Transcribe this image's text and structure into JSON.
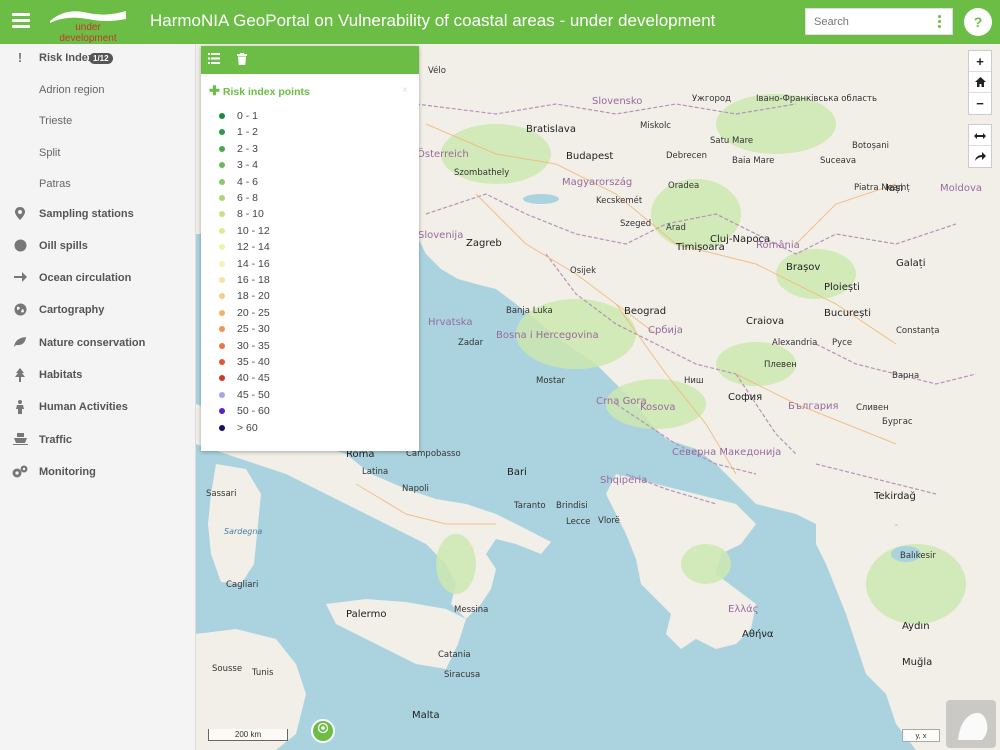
{
  "header": {
    "logo_text": "under development",
    "title": "HarmoNIA GeoPortal on Vulnerability of coastal areas - under development",
    "search_placeholder": "Search",
    "help_label": "?"
  },
  "sidebar": {
    "items": [
      {
        "label": "Risk Index",
        "badge": "1/12",
        "icon": "exclamation-icon"
      },
      {
        "label": "Adrion region"
      },
      {
        "label": "Trieste"
      },
      {
        "label": "Split"
      },
      {
        "label": "Patras"
      },
      {
        "label": "Sampling stations",
        "icon": "map-marker-icon"
      },
      {
        "label": "Oill spills",
        "icon": "circle-icon"
      },
      {
        "label": "Ocean circulation",
        "icon": "arrow-right-icon"
      },
      {
        "label": "Cartography",
        "icon": "globe-icon"
      },
      {
        "label": "Nature conservation",
        "icon": "leaf-icon"
      },
      {
        "label": "Habitats",
        "icon": "tree-icon"
      },
      {
        "label": "Human Activities",
        "icon": "person-icon"
      },
      {
        "label": "Traffic",
        "icon": "ship-icon"
      },
      {
        "label": "Monitoring",
        "icon": "cogs-icon"
      }
    ]
  },
  "legend": {
    "title": "Risk index points",
    "close": "×",
    "classes": [
      {
        "label": "0 - 1",
        "color": "#1a8a3a"
      },
      {
        "label": "1 - 2",
        "color": "#2e9a45"
      },
      {
        "label": "2 - 3",
        "color": "#49a94f"
      },
      {
        "label": "3 - 4",
        "color": "#6bb95a"
      },
      {
        "label": "4 - 6",
        "color": "#8cc866"
      },
      {
        "label": "6 - 8",
        "color": "#acd675"
      },
      {
        "label": "8 - 10",
        "color": "#c6e283"
      },
      {
        "label": "10 - 12",
        "color": "#dceb97"
      },
      {
        "label": "12 - 14",
        "color": "#edf2ad"
      },
      {
        "label": "14 - 16",
        "color": "#f8f1b5"
      },
      {
        "label": "16 - 18",
        "color": "#fbe2a2"
      },
      {
        "label": "18 - 20",
        "color": "#f9cc85"
      },
      {
        "label": "20 - 25",
        "color": "#f6b06a"
      },
      {
        "label": "25 - 30",
        "color": "#f29355"
      },
      {
        "label": "30 - 35",
        "color": "#ec7443"
      },
      {
        "label": "35 - 40",
        "color": "#e15535"
      },
      {
        "label": "40 - 45",
        "color": "#d0382c"
      },
      {
        "label": "45 - 50",
        "color": "#a4a4f0"
      },
      {
        "label": "50 - 60",
        "color": "#5a22c8"
      },
      {
        "label": "> 60",
        "color": "#1a0a6a"
      }
    ]
  },
  "map": {
    "scale_label": "200 km",
    "coords_label": "y, x",
    "places": [
      {
        "text": "Vélo",
        "cls": ""
      },
      {
        "text": "Slovensko",
        "cls": "country"
      },
      {
        "text": "Ужгород",
        "cls": ""
      },
      {
        "text": "Івано-Франківська область",
        "cls": ""
      },
      {
        "text": "Bratislava",
        "cls": "big"
      },
      {
        "text": "Miskolc",
        "cls": ""
      },
      {
        "text": "Budapest",
        "cls": "big"
      },
      {
        "text": "Debrecen",
        "cls": ""
      },
      {
        "text": "Satu Mare",
        "cls": ""
      },
      {
        "text": "Baia Mare",
        "cls": ""
      },
      {
        "text": "Suceava",
        "cls": ""
      },
      {
        "text": "Österreich",
        "cls": "country"
      },
      {
        "text": "Magyarország",
        "cls": "country"
      },
      {
        "text": "Oradea",
        "cls": ""
      },
      {
        "text": "Botoșani",
        "cls": ""
      },
      {
        "text": "Iași",
        "cls": "big"
      },
      {
        "text": "Moldova",
        "cls": "country"
      },
      {
        "text": "Szombathely",
        "cls": ""
      },
      {
        "text": "Kecskemét",
        "cls": ""
      },
      {
        "text": "Cluj-Napoca",
        "cls": "big"
      },
      {
        "text": "Piatra Neamț",
        "cls": ""
      },
      {
        "text": "Slovenija",
        "cls": "country"
      },
      {
        "text": "Zagreb",
        "cls": "big"
      },
      {
        "text": "Szeged",
        "cls": ""
      },
      {
        "text": "Arad",
        "cls": ""
      },
      {
        "text": "Timișoara",
        "cls": "big"
      },
      {
        "text": "România",
        "cls": "country"
      },
      {
        "text": "Brașov",
        "cls": "big"
      },
      {
        "text": "Galați",
        "cls": "big"
      },
      {
        "text": "Osijek",
        "cls": ""
      },
      {
        "text": "Ploiești",
        "cls": "big"
      },
      {
        "text": "Hrvatska",
        "cls": "country"
      },
      {
        "text": "Banja Luka",
        "cls": ""
      },
      {
        "text": "Beograd",
        "cls": "big"
      },
      {
        "text": "Craiova",
        "cls": "big"
      },
      {
        "text": "București",
        "cls": "big"
      },
      {
        "text": "Bosna i Hercegovina",
        "cls": "country"
      },
      {
        "text": "Србија",
        "cls": "country"
      },
      {
        "text": "Constanța",
        "cls": ""
      },
      {
        "text": "Zadar",
        "cls": ""
      },
      {
        "text": "Alexandria",
        "cls": ""
      },
      {
        "text": "Русе",
        "cls": ""
      },
      {
        "text": "Плевен",
        "cls": ""
      },
      {
        "text": "Варна",
        "cls": ""
      },
      {
        "text": "Mostar",
        "cls": ""
      },
      {
        "text": "Ниш",
        "cls": ""
      },
      {
        "text": "Crna Gora",
        "cls": "country"
      },
      {
        "text": "Kosova",
        "cls": "country"
      },
      {
        "text": "София",
        "cls": "big"
      },
      {
        "text": "България",
        "cls": "country"
      },
      {
        "text": "Сливен",
        "cls": ""
      },
      {
        "text": "Бургас",
        "cls": ""
      },
      {
        "text": "Roma",
        "cls": "big"
      },
      {
        "text": "Campobasso",
        "cls": ""
      },
      {
        "text": "Bari",
        "cls": "big"
      },
      {
        "text": "Северна Македонија",
        "cls": "country"
      },
      {
        "text": "Latina",
        "cls": ""
      },
      {
        "text": "Shqipëria",
        "cls": "country"
      },
      {
        "text": "Tekirdağ",
        "cls": "big"
      },
      {
        "text": "Sassari",
        "cls": ""
      },
      {
        "text": "Napoli",
        "cls": ""
      },
      {
        "text": "Taranto",
        "cls": ""
      },
      {
        "text": "Brindisi",
        "cls": ""
      },
      {
        "text": "Lecce",
        "cls": ""
      },
      {
        "text": "Vlorë",
        "cls": ""
      },
      {
        "text": "Sardegna",
        "cls": "sea"
      },
      {
        "text": "Balıkesir",
        "cls": ""
      },
      {
        "text": "Cagliari",
        "cls": ""
      },
      {
        "text": "Palermo",
        "cls": "big"
      },
      {
        "text": "Messina",
        "cls": ""
      },
      {
        "text": "Ελλάς",
        "cls": "country"
      },
      {
        "text": "Αθήνα",
        "cls": "big"
      },
      {
        "text": "Aydın",
        "cls": "big"
      },
      {
        "text": "Catania",
        "cls": ""
      },
      {
        "text": "Siracusa",
        "cls": ""
      },
      {
        "text": "Muğla",
        "cls": "big"
      },
      {
        "text": "Malta",
        "cls": "big"
      },
      {
        "text": "Sousse",
        "cls": ""
      },
      {
        "text": "Tunis",
        "cls": ""
      }
    ]
  },
  "colors": {
    "brand": "#6cbd45",
    "sea": "#aad3df",
    "land": "#f2efe9"
  }
}
